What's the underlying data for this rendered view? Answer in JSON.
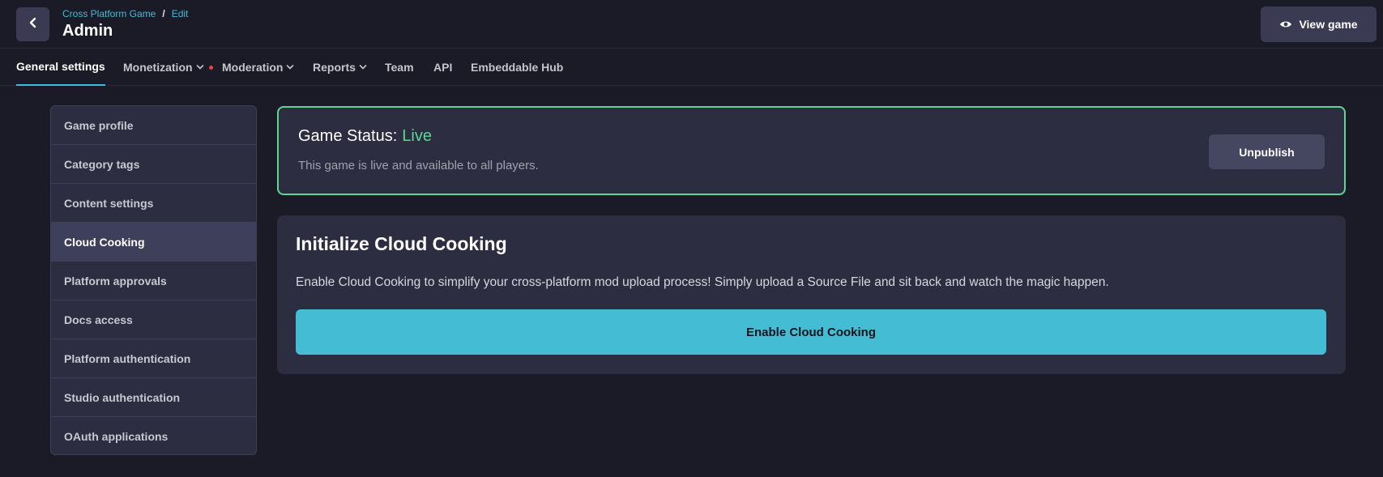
{
  "header": {
    "breadcrumb_game": "Cross Platform Game",
    "breadcrumb_sep": "/",
    "breadcrumb_edit": "Edit",
    "title": "Admin",
    "view_game_label": "View game",
    "back_icon": "chevron-left-icon",
    "view_icon": "eye-icon"
  },
  "tabs": [
    {
      "label": "General settings",
      "active": true
    },
    {
      "label": "Monetization",
      "dropdown": true,
      "alert_dot": true
    },
    {
      "label": "Moderation",
      "dropdown": true
    },
    {
      "label": "Reports",
      "dropdown": true
    },
    {
      "label": "Team"
    },
    {
      "label": "API"
    },
    {
      "label": "Embeddable Hub"
    }
  ],
  "sidebar": {
    "items": [
      {
        "label": "Game profile"
      },
      {
        "label": "Category tags"
      },
      {
        "label": "Content settings"
      },
      {
        "label": "Cloud Cooking",
        "active": true
      },
      {
        "label": "Platform approvals"
      },
      {
        "label": "Docs access"
      },
      {
        "label": "Platform authentication"
      },
      {
        "label": "Studio authentication"
      },
      {
        "label": "OAuth applications"
      }
    ]
  },
  "status": {
    "label": "Game Status:",
    "value": "Live",
    "description": "This game is live and available to all players.",
    "unpublish_label": "Unpublish"
  },
  "cloud_cooking": {
    "title": "Initialize Cloud Cooking",
    "description": "Enable Cloud Cooking to simplify your cross-platform mod upload process! Simply upload a Source File and sit back and watch the magic happen.",
    "button_label": "Enable Cloud Cooking"
  },
  "colors": {
    "background": "#1a1b26",
    "accent": "#41bcd6",
    "live": "#5fd592",
    "alert": "#e64545"
  }
}
